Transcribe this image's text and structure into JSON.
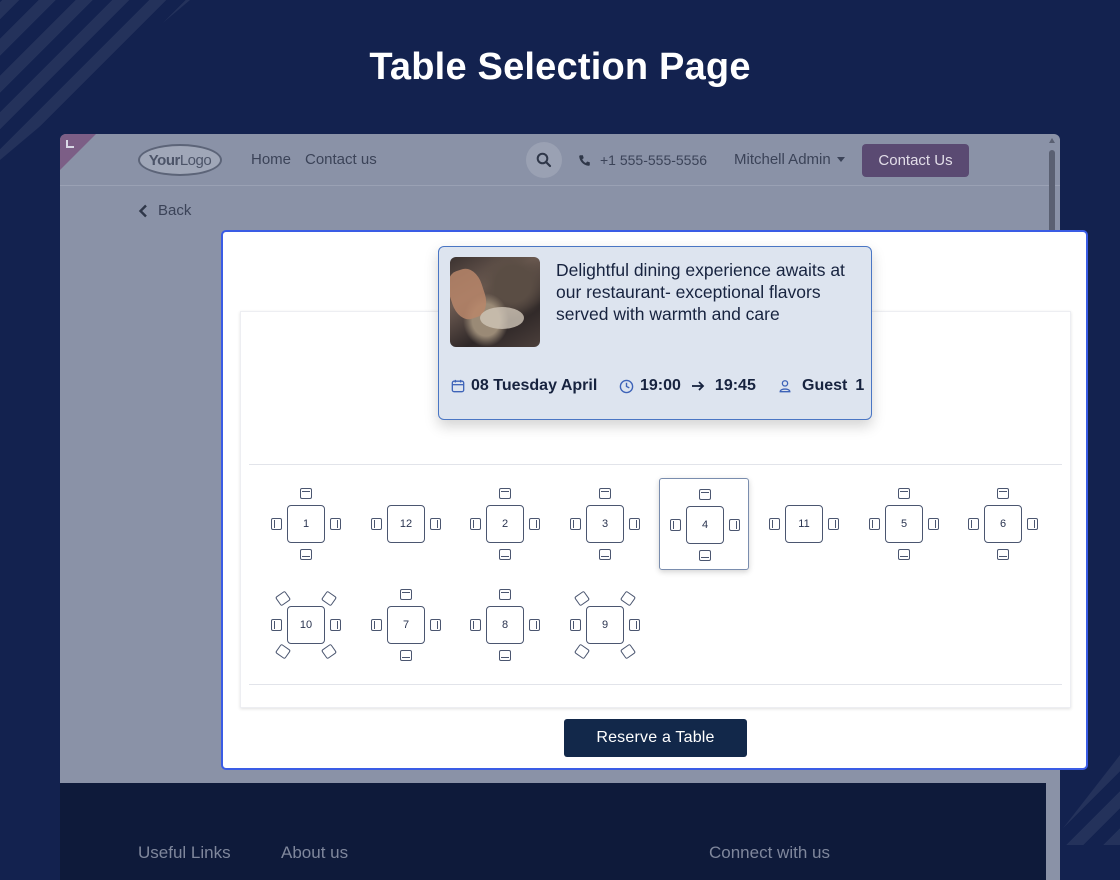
{
  "page_title": "Table Selection Page",
  "site": {
    "logo": {
      "bold": "Your",
      "thin": "Logo"
    },
    "nav": [
      {
        "label": "Home"
      },
      {
        "label": "Contact us"
      }
    ],
    "phone": "+1 555-555-5556",
    "user": "Mitchell Admin",
    "contact_button": "Contact Us",
    "back_label": "Back",
    "footer_links": [
      "Useful Links",
      "About us",
      "Connect with us"
    ]
  },
  "booking": {
    "description": "Delightful dining experience awaits at our restaurant- exceptional flavors served with warmth and care",
    "date": "08 Tuesday April",
    "time_start": "19:00",
    "time_end": "19:45",
    "guests_label": "Guest",
    "guests": "1"
  },
  "tables": [
    {
      "label": "1",
      "layout": "four"
    },
    {
      "label": "12",
      "layout": "two"
    },
    {
      "label": "2",
      "layout": "four"
    },
    {
      "label": "3",
      "layout": "four"
    },
    {
      "label": "4",
      "layout": "four",
      "selected": true
    },
    {
      "label": "11",
      "layout": "two"
    },
    {
      "label": "5",
      "layout": "four"
    },
    {
      "label": "6",
      "layout": "four"
    },
    {
      "label": "10",
      "layout": "six"
    },
    {
      "label": "7",
      "layout": "four"
    },
    {
      "label": "8",
      "layout": "four"
    },
    {
      "label": "9",
      "layout": "six"
    }
  ],
  "reserve_button": "Reserve a Table",
  "colors": {
    "background": "#13224f",
    "accent_border": "#3a5ce5",
    "primary_button": "#12284a",
    "contact_button": "#5a4a72"
  }
}
